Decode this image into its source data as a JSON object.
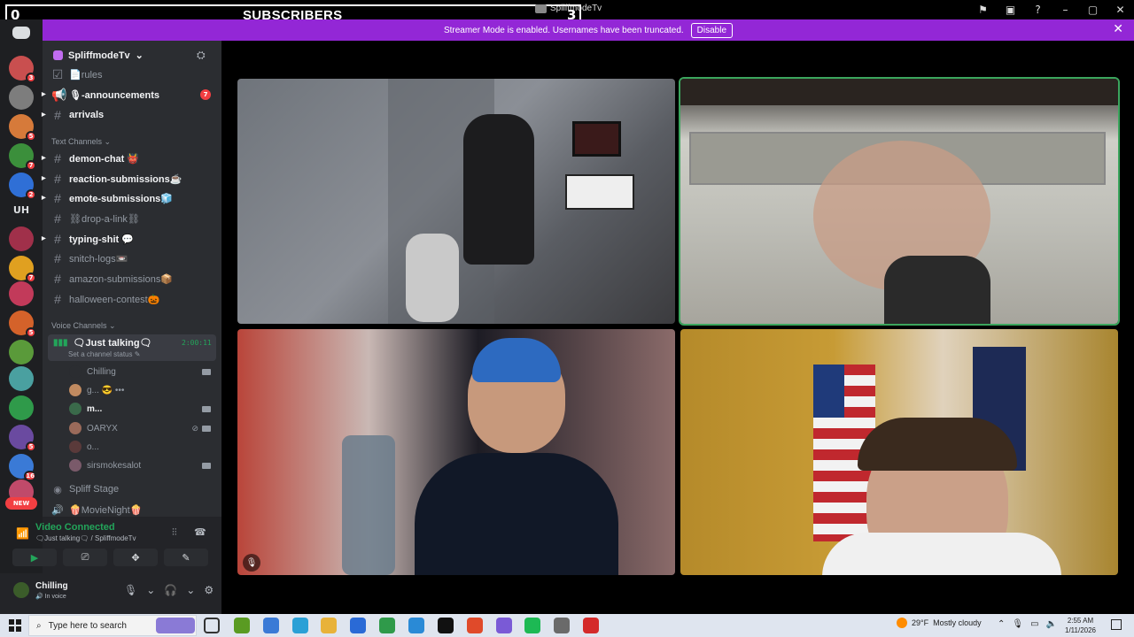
{
  "overlay": {
    "left_count": "0",
    "title": "SUBSCRIBERS",
    "right_count": "3",
    "app_name": "SpliffmodeTv"
  },
  "window_controls": [
    "⚑",
    "▣",
    "?",
    "–",
    "▢",
    "✕"
  ],
  "streamer_mode": {
    "message": "Streamer Mode is enabled. Usernames have been truncated.",
    "button": "Disable"
  },
  "servers": [
    {
      "color": "#c94f4f",
      "badge": "3"
    },
    {
      "color": "#7d7d7d",
      "badge": ""
    },
    {
      "color": "#d67a3a",
      "badge": "5"
    },
    {
      "color": "#3b8f3b",
      "badge": "7"
    },
    {
      "color": "#2f6fd6",
      "badge": "2"
    },
    {
      "label": "UH"
    },
    {
      "color": "#a0304a",
      "badge": ""
    },
    {
      "color": "#e0a020",
      "badge": "7"
    },
    {
      "color": "#c23a5a",
      "badge": ""
    },
    {
      "color": "#d4622a",
      "badge": "5"
    },
    {
      "color": "#5a9a3a",
      "badge": ""
    },
    {
      "color": "#4aa0a0",
      "badge": ""
    },
    {
      "color": "#2f9a4a",
      "badge": ""
    },
    {
      "color": "#6a4aa0",
      "badge": "5"
    },
    {
      "color": "#3a7ad6",
      "badge": "16"
    },
    {
      "color": "#c04a6a",
      "badge": ""
    }
  ],
  "new_badge": "NEW",
  "server_header": {
    "name": "SpliffmodeTv",
    "chevron": "⌄"
  },
  "channels_top": [
    {
      "name": "📄rules",
      "unread": false,
      "icon": "☑"
    },
    {
      "name": "🎙-announcements",
      "unread": true,
      "icon": "📢",
      "mention": "7"
    },
    {
      "name": "arrivals",
      "unread": true,
      "icon": "#"
    }
  ],
  "text_category": "Text Channels",
  "text_channels": [
    {
      "name": "demon-chat 👹",
      "unread": true
    },
    {
      "name": "reaction-submissions☕",
      "unread": true
    },
    {
      "name": "emote-submissions🧊",
      "unread": true
    },
    {
      "name": "⛓drop-a-link⛓",
      "unread": false
    },
    {
      "name": "typing-shit 💬",
      "unread": true
    },
    {
      "name": "snitch-logs📼",
      "unread": false
    },
    {
      "name": "amazon-submissions📦",
      "unread": false
    },
    {
      "name": "halloween-contest🎃",
      "unread": false
    }
  ],
  "voice_category": "Voice Channels",
  "active_voice": {
    "name": "🗨Just talking🗨",
    "timer": "2:00:11",
    "status": "Set a channel status ✎"
  },
  "voice_users": [
    {
      "name": "Chilling",
      "bright": false,
      "cam": true,
      "mute": false
    },
    {
      "name": "g... 😎 •••",
      "bright": false,
      "cam": false,
      "mute": false
    },
    {
      "name": "m...",
      "bright": true,
      "cam": true,
      "mute": false
    },
    {
      "name": "OARYX",
      "bright": false,
      "cam": true,
      "mute": true
    },
    {
      "name": "o...",
      "bright": false,
      "cam": false,
      "mute": false
    },
    {
      "name": "sirsmokesalot",
      "bright": false,
      "cam": true,
      "mute": false
    }
  ],
  "other_voice": [
    {
      "name": "Spliff Stage",
      "icon": "◉"
    },
    {
      "name": "🍿MovieNight🍿",
      "icon": "🔊"
    }
  ],
  "voice_panel": {
    "status": "Video Connected",
    "channel": "🗨Just talking🗨 / SpliffmodeTv",
    "buttons": [
      "▶",
      "⎚",
      "✥",
      "✎"
    ]
  },
  "user_panel": {
    "name": "Chilling",
    "status": "🔊 In voice"
  },
  "taskbar": {
    "search_placeholder": "Type here to search",
    "weather_temp": "29°F",
    "weather_desc": "Mostly cloudy",
    "time": "2:55 AM",
    "date": "1/11/2026",
    "icons": [
      "#5a9b22",
      "#3a7ad6",
      "#2aa0d6",
      "#e8b23a",
      "#2a6ad6",
      "#2f9a4a",
      "#2a8ad6",
      "#111111",
      "#e04a2a",
      "#7a5ad6",
      "#1db954",
      "#6a6a6a",
      "#d42a2a"
    ]
  }
}
